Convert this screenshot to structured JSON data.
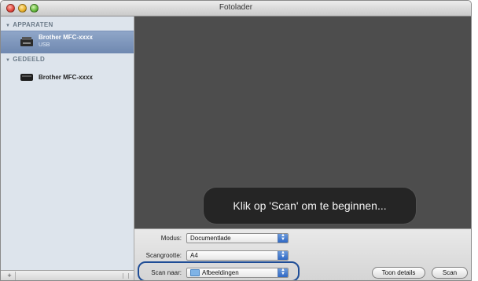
{
  "window": {
    "title": "Fotolader"
  },
  "sidebar": {
    "sections": [
      {
        "header": "APPARATEN",
        "devices": [
          {
            "name": "Brother MFC-xxxx",
            "sub": "USB",
            "selected": true
          }
        ]
      },
      {
        "header": "GEDEELD",
        "devices": [
          {
            "name": "Brother MFC-xxxx",
            "selected": false
          }
        ]
      }
    ],
    "add_label": "+"
  },
  "preview": {
    "hint": "Klik op 'Scan' om te beginnen..."
  },
  "controls": {
    "mode_label": "Modus:",
    "mode_value": "Documentlade",
    "size_label": "Scangrootte:",
    "size_value": "A4",
    "scan_to_label": "Scan naar:",
    "scan_to_value": "Afbeeldingen",
    "details_button": "Toon details",
    "scan_button": "Scan"
  },
  "colors": {
    "highlight": "#1f4d96",
    "preview_bg": "#4d4d4d",
    "selected_row": "#7f97bd"
  }
}
